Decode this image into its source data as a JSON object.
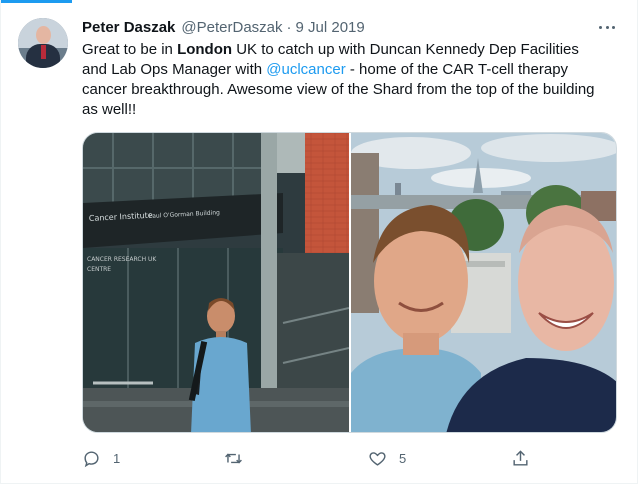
{
  "tweet": {
    "author_name": "Peter Daszak",
    "handle": "@PeterDaszak",
    "separator": "·",
    "date": "9 Jul 2019",
    "text_part1": "Great to be in ",
    "text_bold": "London",
    "text_part2": " UK to catch up with Duncan Kennedy Dep Facilities and Lab Ops Manager with ",
    "text_mention": "@uclcancer",
    "text_part3": " - home of the CAR T-cell therapy cancer breakthrough. Awesome view of the Shard from the top of the building as well!!"
  },
  "media": {
    "left_sign_line1": "Cancer Institute",
    "left_sign_line2": "Paul O'Gorman Building",
    "left_sign_line3": "CANCER RESEARCH UK",
    "left_sign_line4": "CENTRE"
  },
  "actions": {
    "reply_count": "1",
    "retweet_count": "",
    "like_count": "5"
  },
  "icons": {
    "reply": "reply-icon",
    "retweet": "retweet-icon",
    "like": "heart-icon",
    "share": "share-icon",
    "more": "more-icon"
  },
  "colors": {
    "accent": "#1d9bf0",
    "secondary_text": "#536471",
    "primary_text": "#0f1419"
  }
}
